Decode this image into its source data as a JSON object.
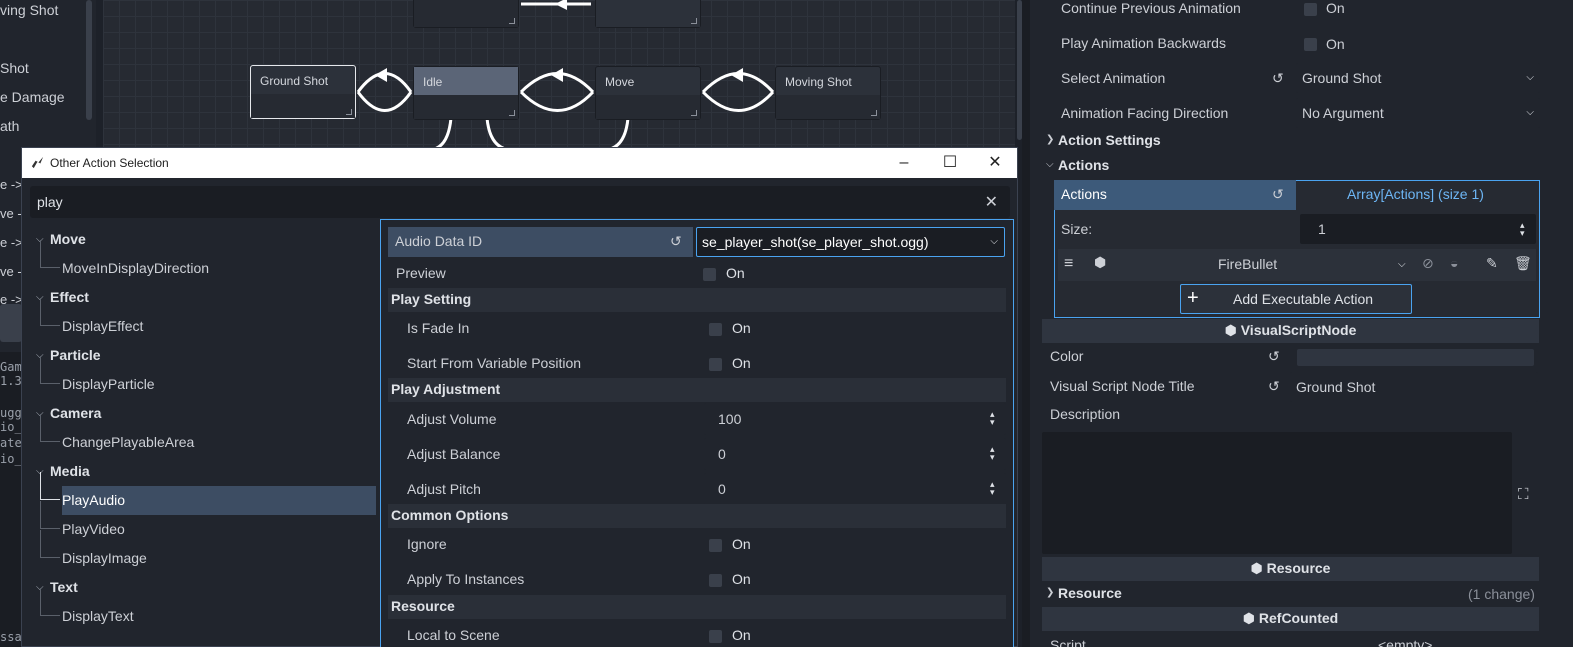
{
  "left_panel": {
    "items": [
      "ving Shot",
      "Shot",
      "e Damage",
      "ath"
    ],
    "arrows": [
      "e ->",
      "ve -",
      "e ->",
      "ve -",
      "e ->"
    ],
    "console": [
      "Gam",
      "1.3",
      "ugg",
      "io_",
      "ate",
      "io_",
      "ssa"
    ]
  },
  "graph": {
    "nodes": [
      "Ground Shot",
      "Idle",
      "Move",
      "Moving Shot"
    ]
  },
  "dialog": {
    "title": "Other Action Selection",
    "search_value": "play",
    "clear_icon": "✕",
    "tree": [
      {
        "category": "Move",
        "items": [
          "MoveInDisplayDirection"
        ]
      },
      {
        "category": "Effect",
        "items": [
          "DisplayEffect"
        ]
      },
      {
        "category": "Particle",
        "items": [
          "DisplayParticle"
        ]
      },
      {
        "category": "Camera",
        "items": [
          "ChangePlayableArea"
        ]
      },
      {
        "category": "Media",
        "items": [
          "PlayAudio",
          "PlayVideo",
          "DisplayImage"
        ]
      },
      {
        "category": "Text",
        "items": [
          "DisplayText"
        ]
      }
    ],
    "props": {
      "audio_data_id_label": "Audio Data ID",
      "audio_data_id_value": "se_player_shot(se_player_shot.ogg)",
      "preview_label": "Preview",
      "on": "On",
      "play_setting": "Play Setting",
      "is_fade_in": "Is Fade In",
      "start_from_variable": "Start From Variable Position",
      "play_adjustment": "Play Adjustment",
      "adjust_volume": "Adjust Volume",
      "adjust_volume_value": "100",
      "adjust_balance": "Adjust Balance",
      "adjust_balance_value": "0",
      "adjust_pitch": "Adjust Pitch",
      "adjust_pitch_value": "0",
      "common_options": "Common Options",
      "ignore": "Ignore",
      "apply_to_instances": "Apply To Instances",
      "resource": "Resource",
      "local_to_scene": "Local to Scene"
    }
  },
  "inspector": {
    "continue_prev_anim": "Continue Previous Animation",
    "play_anim_backwards": "Play Animation Backwards",
    "select_animation": "Select Animation",
    "select_animation_value": "Ground Shot",
    "anim_facing": "Animation Facing Direction",
    "anim_facing_value": "No Argument",
    "on": "On",
    "action_settings": "Action Settings",
    "actions_group": "Actions",
    "actions_label": "Actions",
    "actions_value": "Array[Actions] (size 1)",
    "size_label": "Size:",
    "size_value": "1",
    "fire_bullet": "FireBullet",
    "add_exec_action": "Add Executable Action",
    "visual_script_node": "VisualScriptNode",
    "color_label": "Color",
    "vs_title_label": "Visual Script Node Title",
    "vs_title_value": "Ground Shot",
    "description_label": "Description",
    "resource_header": "Resource",
    "resource_group": "Resource",
    "resource_changes": "(1 change)",
    "refcounted": "RefCounted",
    "script_label": "Script",
    "script_value": "<empty>"
  },
  "colors": {
    "accent": "#4aa3f0",
    "selected_row": "#3d4d63",
    "panel_bg": "#21252d",
    "field_bg": "#1a1d23"
  }
}
